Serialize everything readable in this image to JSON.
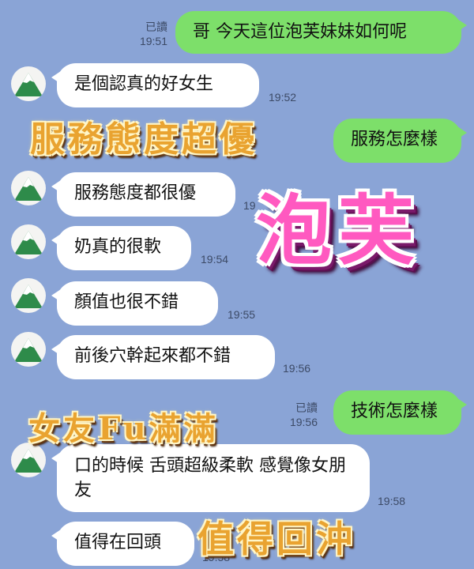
{
  "colors": {
    "background": "#8aa4d6",
    "incoming_bubble": "#ffffff",
    "outgoing_bubble": "#7ddf6a"
  },
  "messages": [
    {
      "side": "out",
      "text": "哥 今天這位泡芙妹妹如何呢",
      "read": "已讀",
      "time": "19:51"
    },
    {
      "side": "in",
      "text": "是個認真的好女生",
      "time": "19:52"
    },
    {
      "side": "out",
      "text": "服務怎麼樣"
    },
    {
      "side": "in",
      "text": "服務態度都很優",
      "time": "19"
    },
    {
      "side": "in",
      "text": "奶真的很軟",
      "time": "19:54"
    },
    {
      "side": "in",
      "text": "顏值也很不錯",
      "time": "19:55"
    },
    {
      "side": "in",
      "text": "前後穴幹起來都不錯",
      "time": "19:56"
    },
    {
      "side": "out",
      "text": "技術怎麼樣",
      "read": "已讀",
      "time": "19:56"
    },
    {
      "side": "in",
      "text": "口的時候 舌頭超級柔軟 感覺像女朋友",
      "time": "19:58"
    },
    {
      "side": "in",
      "text": "值得在回頭",
      "time": "19:58"
    }
  ],
  "overlays": {
    "service": "服務態度超優",
    "name": "泡芙",
    "girlfriend": "女友Fu滿滿",
    "revisit": "值得回沖"
  },
  "avatar_icon": "mountain-icon"
}
